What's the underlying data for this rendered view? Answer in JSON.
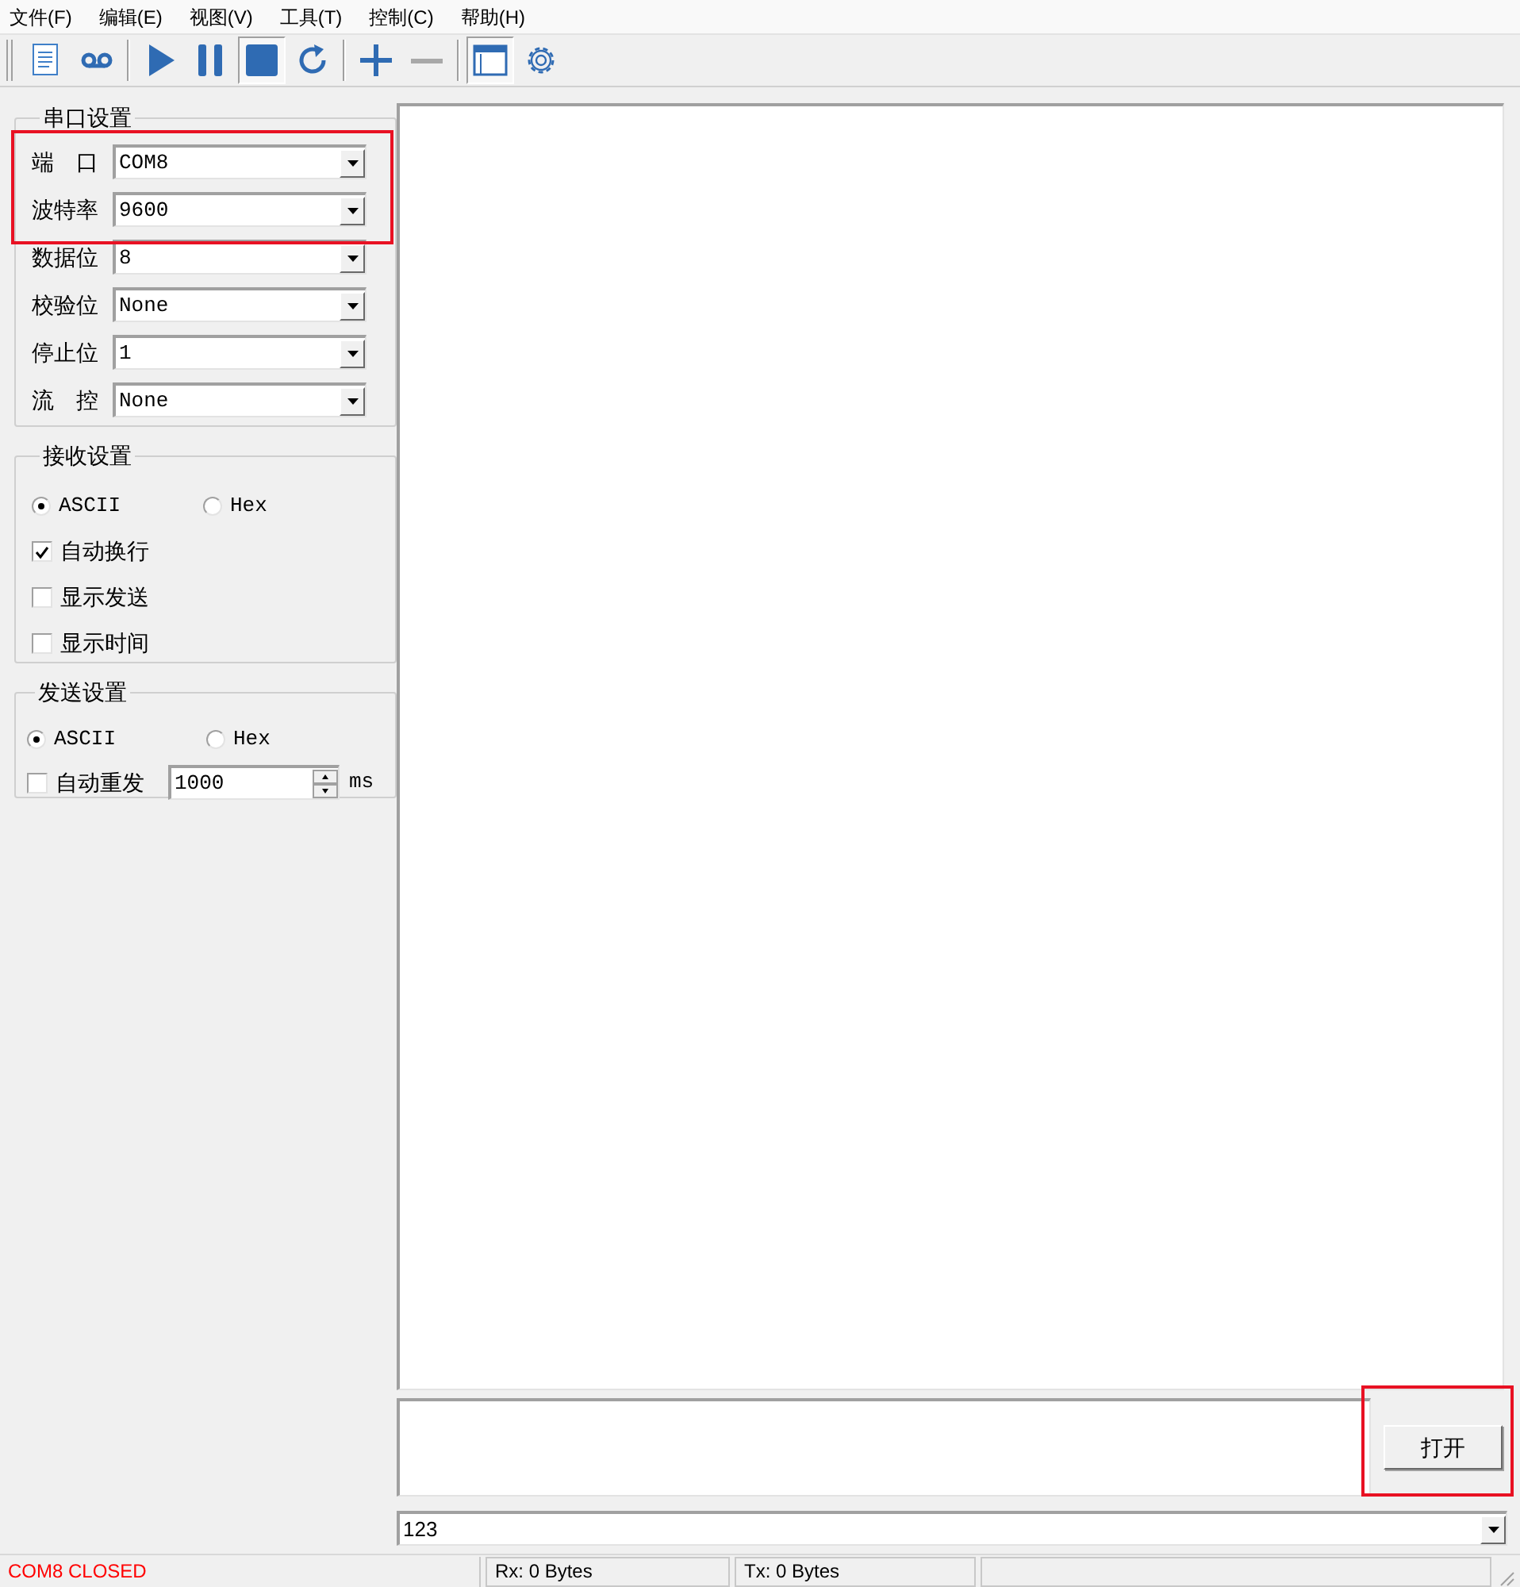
{
  "menu": [
    {
      "label": "文件(F)"
    },
    {
      "label": "编辑(E)"
    },
    {
      "label": "视图(V)"
    },
    {
      "label": "工具(T)"
    },
    {
      "label": "控制(C)"
    },
    {
      "label": "帮助(H)"
    }
  ],
  "toolbar": [
    [
      {
        "kind": "document",
        "pressed": false,
        "disabled": false
      },
      {
        "kind": "record",
        "pressed": false,
        "disabled": false
      }
    ],
    [
      {
        "kind": "play",
        "pressed": false,
        "disabled": false
      },
      {
        "kind": "pause",
        "pressed": false,
        "disabled": false
      },
      {
        "kind": "stop",
        "pressed": true,
        "disabled": false
      },
      {
        "kind": "refresh",
        "pressed": false,
        "disabled": false
      }
    ],
    [
      {
        "kind": "plus",
        "pressed": false,
        "disabled": false
      },
      {
        "kind": "minus",
        "pressed": false,
        "disabled": true
      }
    ],
    [
      {
        "kind": "window",
        "pressed": true,
        "disabled": false
      },
      {
        "kind": "gear",
        "pressed": false,
        "disabled": false
      }
    ]
  ],
  "serial_settings": {
    "title": "串口设置",
    "fields": [
      {
        "label": "端　口",
        "value": "COM8"
      },
      {
        "label": "波特率",
        "value": "9600"
      },
      {
        "label": "数据位",
        "value": "8"
      },
      {
        "label": "校验位",
        "value": "None"
      },
      {
        "label": "停止位",
        "value": "1"
      },
      {
        "label": "流　控",
        "value": "None"
      }
    ]
  },
  "receive_settings": {
    "title": "接收设置",
    "modes": [
      {
        "label": "ASCII",
        "selected": true
      },
      {
        "label": "Hex",
        "selected": false
      }
    ],
    "options": [
      {
        "label": "自动换行",
        "checked": true
      },
      {
        "label": "显示发送",
        "checked": false
      },
      {
        "label": "显示时间",
        "checked": false
      }
    ]
  },
  "send_settings": {
    "title": "发送设置",
    "modes": [
      {
        "label": "ASCII",
        "selected": true
      },
      {
        "label": "Hex",
        "selected": false
      }
    ],
    "auto_resend": {
      "label": "自动重发",
      "checked": false,
      "value": "1000",
      "unit": "ms"
    }
  },
  "open_button": "打开",
  "history": {
    "value": "123"
  },
  "status_bar": {
    "port_state": "COM8 CLOSED",
    "rx": "Rx: 0 Bytes",
    "tx": "Tx: 0 Bytes"
  }
}
